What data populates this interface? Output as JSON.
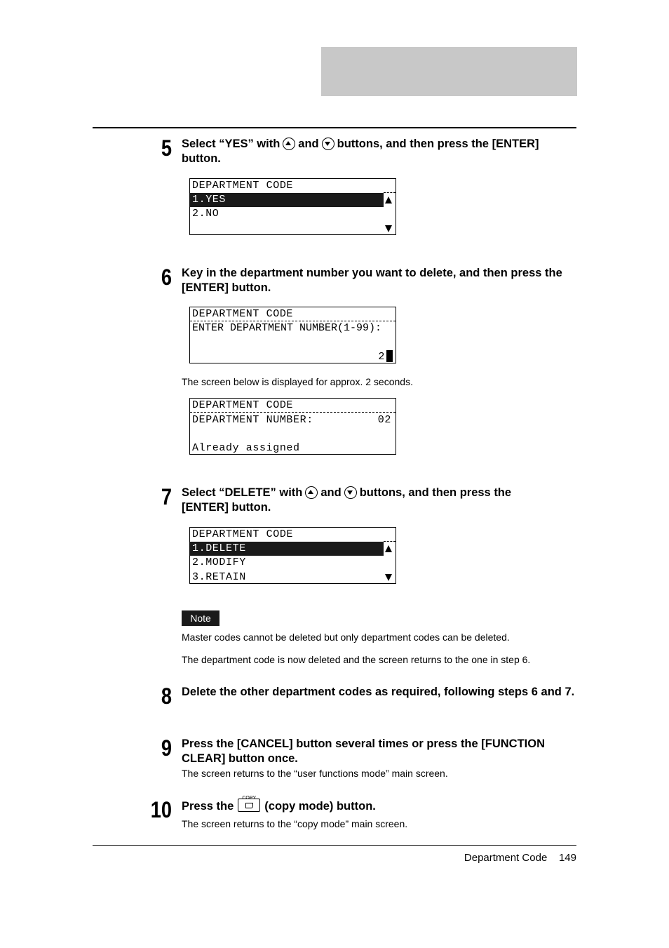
{
  "steps": [
    {
      "number": "5",
      "text_a": "Select “YES” with",
      "and": "and",
      "text_b": "buttons, and then press the [ENTER] button."
    },
    {
      "number": "6",
      "text": "Key in the department number you want to delete, and then press the [ENTER] button."
    },
    {
      "number": "7",
      "text_a": "Select “DELETE” with",
      "and": "and",
      "text_b": "buttons, and then press the [ENTER] button."
    },
    {
      "number": "8",
      "text": "Delete the other department codes as required, following steps 6 and 7."
    },
    {
      "number": "9",
      "text": "Press the [CANCEL] button several times or press the [FUNCTION CLEAR] button once.",
      "sub": "The screen returns to the “user functions mode” main screen."
    },
    {
      "number": "10",
      "text_a": "Press the",
      "button_label": "COPY",
      "text_b": "(copy mode) button.",
      "sub": "The screen returns to the “copy mode” main screen."
    }
  ],
  "icons": {
    "up": "up-arrow-button-icon",
    "down": "down-arrow-button-icon",
    "copy": "copy-mode-button-icon"
  },
  "lcd1": {
    "title": "DEPARTMENT CODE",
    "items": [
      "1.YES",
      "2.NO"
    ],
    "selected": 0
  },
  "lcd2": {
    "title": "DEPARTMENT CODE",
    "prompt": "ENTER DEPARTMENT NUMBER(1-99):",
    "value": "2"
  },
  "info_text": "The screen below is displayed for approx. 2 seconds.",
  "lcd3": {
    "title": "DEPARTMENT CODE",
    "label": "DEPARTMENT NUMBER:",
    "value": "02",
    "message": "Already assigned"
  },
  "lcd4": {
    "title": "DEPARTMENT CODE",
    "items": [
      "1.DELETE",
      "2.MODIFY",
      "3.RETAIN"
    ],
    "selected": 0
  },
  "note": {
    "label": "Note",
    "text": "Master codes cannot be deleted but only department codes can be deleted."
  },
  "after_note": "The department code is now deleted and the screen returns to the one in step 6.",
  "footer": {
    "section": "Department Code",
    "page": "149"
  }
}
